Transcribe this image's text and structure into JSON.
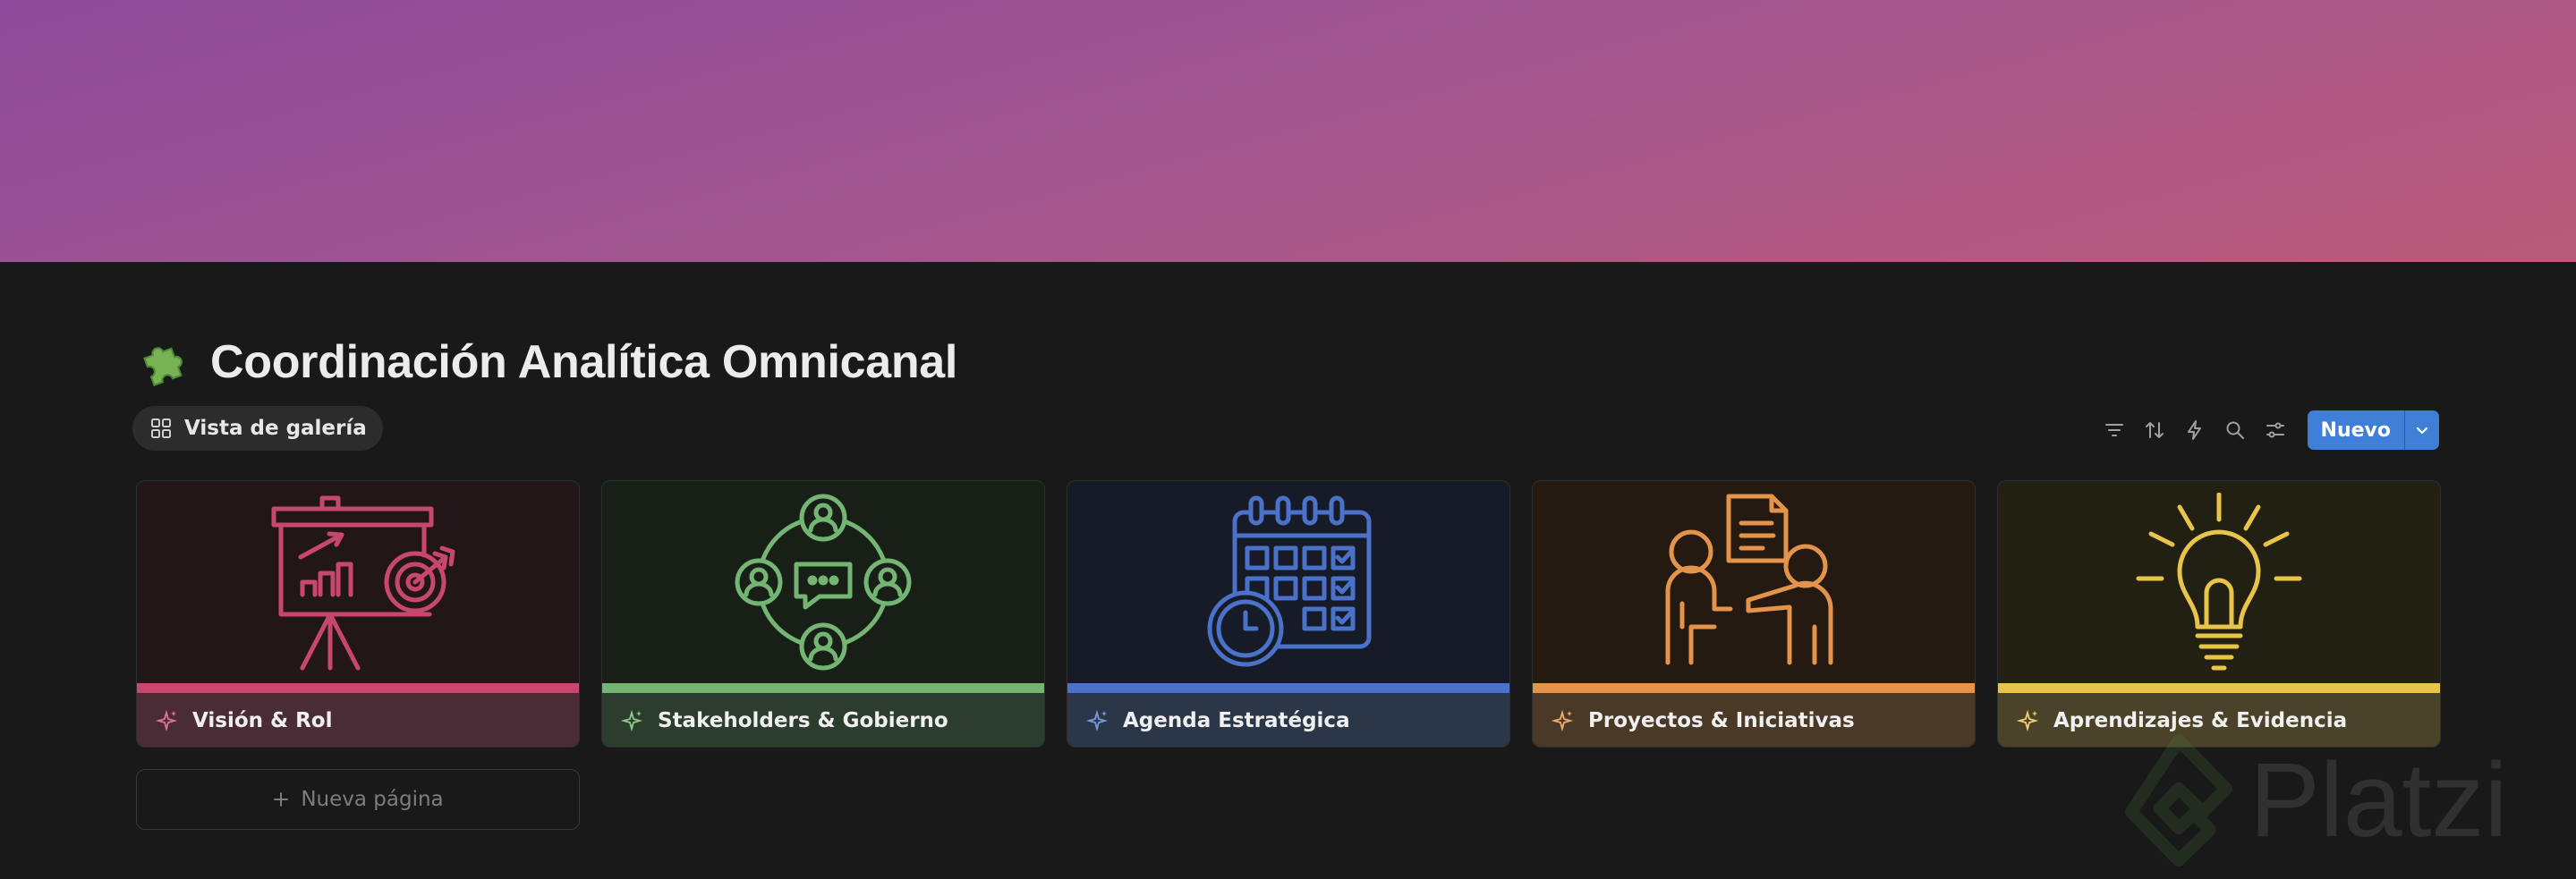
{
  "page": {
    "title": "Coordinación Analítica Omnicanal",
    "emoji": "puzzle-piece-icon"
  },
  "view": {
    "label": "Vista de galería",
    "icon": "gallery-grid-icon"
  },
  "toolbar": {
    "tools": [
      "filter-icon",
      "sort-icon",
      "automation-bolt-icon",
      "search-icon",
      "settings-sliders-icon"
    ],
    "new_label": "Nuevo",
    "new_color": "#3f7fd8"
  },
  "cards": [
    {
      "label": "Visión & Rol",
      "icon": "presentation-target-icon",
      "bg": "#221619",
      "bar": "#c8486d",
      "footer": "#4a2c36",
      "stroke": "#c8486d"
    },
    {
      "label": "Stakeholders & Gobierno",
      "icon": "stakeholders-network-icon",
      "bg": "#171f17",
      "bar": "#74b574",
      "footer": "#2c3c2d",
      "stroke": "#74b574"
    },
    {
      "label": "Agenda Estratégica",
      "icon": "calendar-clock-icon",
      "bg": "#161b27",
      "bar": "#4a72c9",
      "footer": "#2b3649",
      "stroke": "#4a72c9"
    },
    {
      "label": "Proyectos & Iniciativas",
      "icon": "people-document-icon",
      "bg": "#241a12",
      "bar": "#e4944a",
      "footer": "#4b3928",
      "stroke": "#e4944a"
    },
    {
      "label": "Aprendizajes & Evidencia",
      "icon": "lightbulb-icon",
      "bg": "#222012",
      "bar": "#e8c44a",
      "footer": "#4a4329",
      "stroke": "#e8c44a"
    }
  ],
  "new_page": {
    "label": "Nueva página"
  },
  "watermark": {
    "text": "Platzi"
  }
}
